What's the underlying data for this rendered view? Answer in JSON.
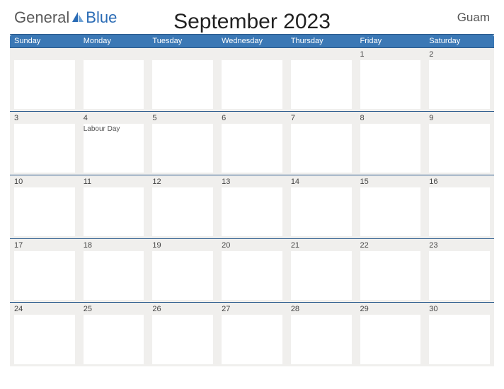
{
  "logo": {
    "part1": "General",
    "part2": "Blue"
  },
  "title": "September 2023",
  "region": "Guam",
  "day_headers": [
    "Sunday",
    "Monday",
    "Tuesday",
    "Wednesday",
    "Thursday",
    "Friday",
    "Saturday"
  ],
  "weeks": [
    [
      {
        "day": "",
        "event": ""
      },
      {
        "day": "",
        "event": ""
      },
      {
        "day": "",
        "event": ""
      },
      {
        "day": "",
        "event": ""
      },
      {
        "day": "",
        "event": ""
      },
      {
        "day": "1",
        "event": ""
      },
      {
        "day": "2",
        "event": ""
      }
    ],
    [
      {
        "day": "3",
        "event": ""
      },
      {
        "day": "4",
        "event": "Labour Day"
      },
      {
        "day": "5",
        "event": ""
      },
      {
        "day": "6",
        "event": ""
      },
      {
        "day": "7",
        "event": ""
      },
      {
        "day": "8",
        "event": ""
      },
      {
        "day": "9",
        "event": ""
      }
    ],
    [
      {
        "day": "10",
        "event": ""
      },
      {
        "day": "11",
        "event": ""
      },
      {
        "day": "12",
        "event": ""
      },
      {
        "day": "13",
        "event": ""
      },
      {
        "day": "14",
        "event": ""
      },
      {
        "day": "15",
        "event": ""
      },
      {
        "day": "16",
        "event": ""
      }
    ],
    [
      {
        "day": "17",
        "event": ""
      },
      {
        "day": "18",
        "event": ""
      },
      {
        "day": "19",
        "event": ""
      },
      {
        "day": "20",
        "event": ""
      },
      {
        "day": "21",
        "event": ""
      },
      {
        "day": "22",
        "event": ""
      },
      {
        "day": "23",
        "event": ""
      }
    ],
    [
      {
        "day": "24",
        "event": ""
      },
      {
        "day": "25",
        "event": ""
      },
      {
        "day": "26",
        "event": ""
      },
      {
        "day": "27",
        "event": ""
      },
      {
        "day": "28",
        "event": ""
      },
      {
        "day": "29",
        "event": ""
      },
      {
        "day": "30",
        "event": ""
      }
    ]
  ]
}
